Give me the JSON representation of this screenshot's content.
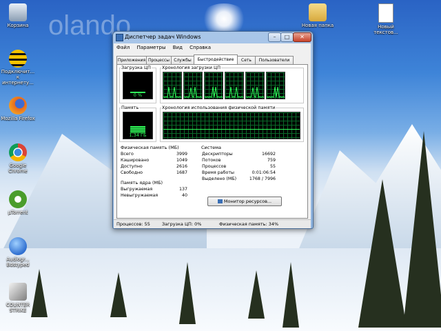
{
  "desktop": {
    "icons": [
      {
        "label": "Корзина",
        "icon": "recycle-bin-icon",
        "color": "#b9c7d6"
      },
      {
        "label": "Подключит... к интернету...",
        "icon": "beeline-icon",
        "color": "#f5c400"
      },
      {
        "label": "Mozilla Firefox",
        "icon": "firefox-icon",
        "color": "#e66a1f"
      },
      {
        "label": "Google Chrome",
        "icon": "chrome-icon",
        "color": "#3b8be0"
      },
      {
        "label": "µTorrent",
        "icon": "utorrent-icon",
        "color": "#4a9d2c"
      },
      {
        "label": "Audiogr... Bdstyped",
        "icon": "audio-app-icon",
        "color": "#2f6fd0"
      },
      {
        "label": "COUNTER STRIKE",
        "icon": "counter-strike-icon",
        "color": "#c9c9c9"
      },
      {
        "label": "Новая папка",
        "icon": "folder-icon",
        "color": "#e8c35c"
      },
      {
        "label": "Новый текстов...",
        "icon": "text-file-icon",
        "color": "#ffffff"
      }
    ],
    "watermark": "olando"
  },
  "window": {
    "title": "Диспетчер задач Windows",
    "buttons": {
      "minimize": "–",
      "maximize": "□",
      "close": "✕"
    },
    "menu": [
      "Файл",
      "Параметры",
      "Вид",
      "Справка"
    ],
    "tabs": [
      {
        "label": "Приложения",
        "active": false
      },
      {
        "label": "Процессы",
        "active": false
      },
      {
        "label": "Службы",
        "active": false
      },
      {
        "label": "Быстродействие",
        "active": true
      },
      {
        "label": "Сеть",
        "active": false
      },
      {
        "label": "Пользователи",
        "active": false
      }
    ],
    "performance": {
      "cpu_usage_label": "Загрузка ЦП",
      "cpu_usage_value": "0 %",
      "cpu_usage_fraction": 0.0,
      "cpu_history_label": "Хронология загрузки ЦП",
      "memory_label": "Память",
      "memory_value": "1,34 ГБ",
      "memory_fraction": 0.34,
      "memory_history_label": "Хронология использования физической памяти",
      "physical_memory": {
        "title": "Физическая память (МБ)",
        "rows": [
          {
            "k": "Всего",
            "v": "3999"
          },
          {
            "k": "Кэшировано",
            "v": "1049"
          },
          {
            "k": "Доступно",
            "v": "2616"
          },
          {
            "k": "Свободно",
            "v": "1687"
          }
        ]
      },
      "kernel_memory": {
        "title": "Память ядра (МБ)",
        "rows": [
          {
            "k": "Выгружаемая",
            "v": "137"
          },
          {
            "k": "Невыгружаемая",
            "v": "40"
          }
        ]
      },
      "system": {
        "title": "Система",
        "rows": [
          {
            "k": "Дескрипторы",
            "v": "16692"
          },
          {
            "k": "Потоков",
            "v": "759"
          },
          {
            "k": "Процессов",
            "v": "55"
          },
          {
            "k": "Время работы",
            "v": "0:01:06:54"
          },
          {
            "k": "Выделено (МБ)",
            "v": "1768 / 7996"
          }
        ]
      },
      "resource_monitor_button": "Монитор ресурсов..."
    },
    "status": {
      "processes": "Процессов: 55",
      "cpu": "Загрузка ЦП: 0%",
      "memory": "Физическая память: 34%"
    }
  },
  "colors": {
    "graph_line": "#31ff5a",
    "grid": "#0a6a2a",
    "accent": "#3a6fb5"
  }
}
